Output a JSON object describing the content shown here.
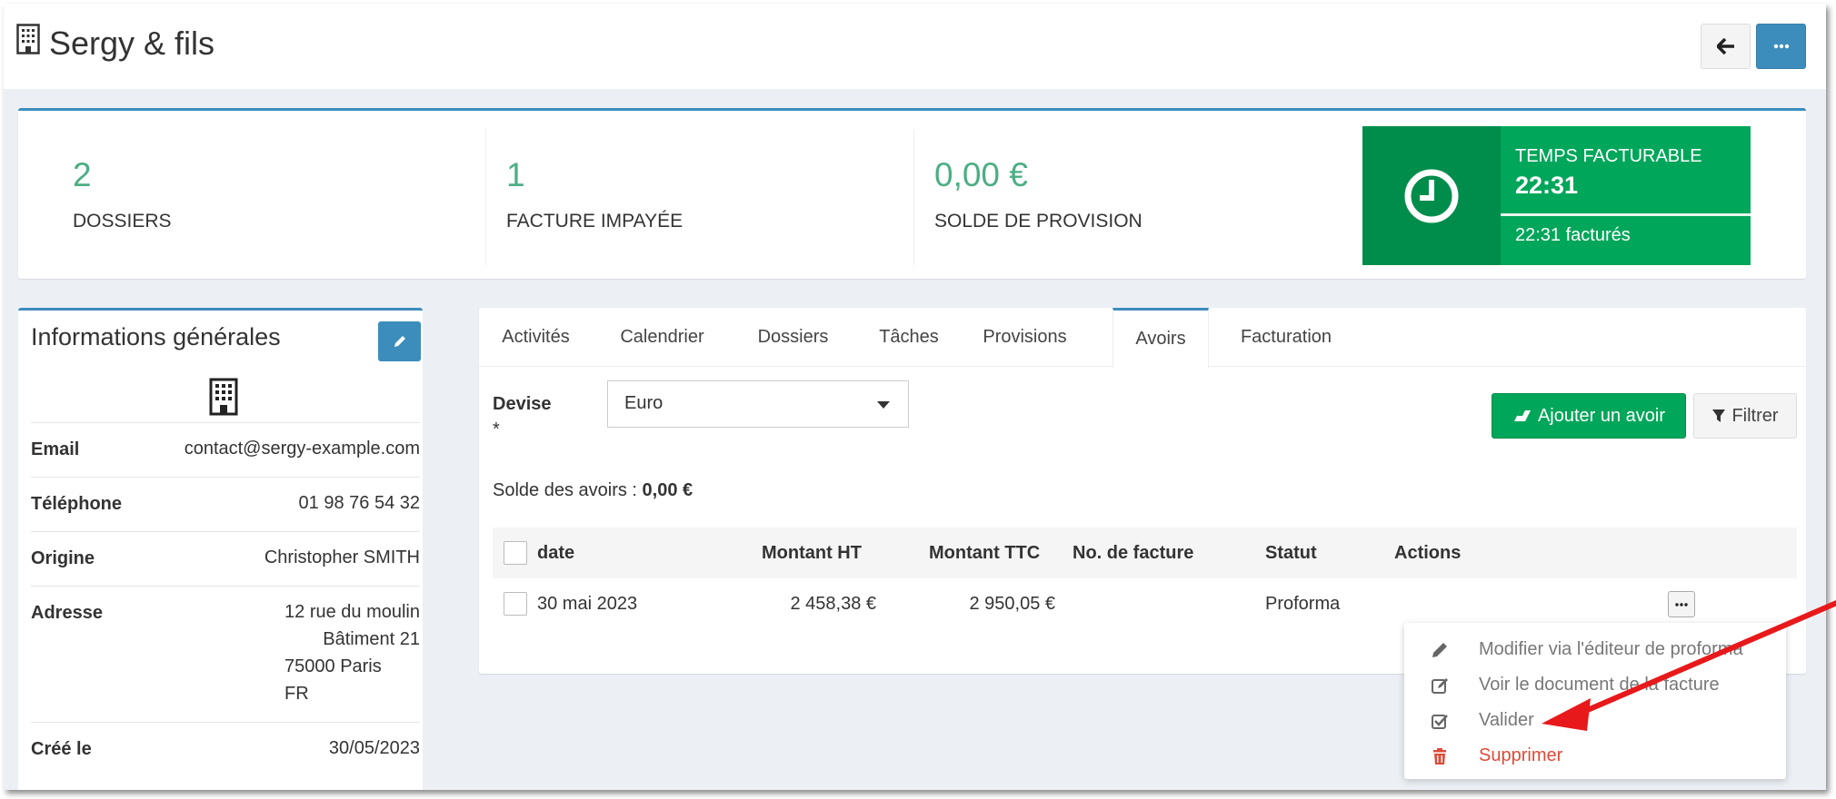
{
  "header": {
    "title": "Sergy & fils",
    "building_icon": "building-icon",
    "back_icon": "arrow-left-icon",
    "more_icon": "ellipsis-icon"
  },
  "stats": [
    {
      "value": "2",
      "label": "DOSSIERS"
    },
    {
      "value": "1",
      "label": "FACTURE IMPAYÉE"
    },
    {
      "value": "0,00 €",
      "label": "SOLDE DE PROVISION"
    }
  ],
  "time": {
    "label": "TEMPS FACTURABLE",
    "value": "22:31",
    "footer": "22:31 facturés",
    "icon": "clock-icon"
  },
  "info": {
    "title": "Informations générales",
    "rows": [
      {
        "key": "Email",
        "value": "contact@sergy-example.com"
      },
      {
        "key": "Téléphone",
        "value": "01 98 76 54 32"
      },
      {
        "key": "Origine",
        "value": "Christopher SMITH"
      },
      {
        "key": "Adresse",
        "lines": [
          "12 rue du moulin",
          "Bâtiment 21",
          "75000 Paris",
          "FR"
        ]
      },
      {
        "key": "Créé le",
        "value": "30/05/2023"
      }
    ]
  },
  "tabs": [
    "Activités",
    "Calendrier",
    "Dossiers",
    "Tâches",
    "Provisions",
    "Avoirs",
    "Facturation"
  ],
  "active_tab": "Avoirs",
  "form": {
    "devise_label": "Devise",
    "required_mark": "*",
    "devise_value": "Euro",
    "add_button": "Ajouter un avoir",
    "filter_button": "Filtrer",
    "solde_label": "Solde des avoirs :",
    "solde_value": "0,00 €"
  },
  "table": {
    "columns": [
      "date",
      "Montant HT",
      "Montant TTC",
      "No. de facture",
      "Statut",
      "Actions"
    ],
    "rows": [
      {
        "date": "30 mai 2023",
        "ht": "2 458,38 €",
        "ttc": "2 950,05 €",
        "facture": "",
        "statut": "Proforma"
      }
    ]
  },
  "dropdown": {
    "items": [
      {
        "label": "Modifier via l'éditeur de proforma",
        "icon": "pencil-icon"
      },
      {
        "label": "Voir le document de la facture",
        "icon": "edit-square-icon"
      },
      {
        "label": "Valider",
        "icon": "check-square-icon"
      },
      {
        "label": "Supprimer",
        "icon": "trash-icon"
      }
    ]
  },
  "colors": {
    "primary": "#3c8dbc",
    "success": "#00a65a",
    "success_dark": "#008d4c",
    "stat_green": "#4cae84",
    "danger": "#dd4b39",
    "annotation_arrow": "#e8191b"
  }
}
